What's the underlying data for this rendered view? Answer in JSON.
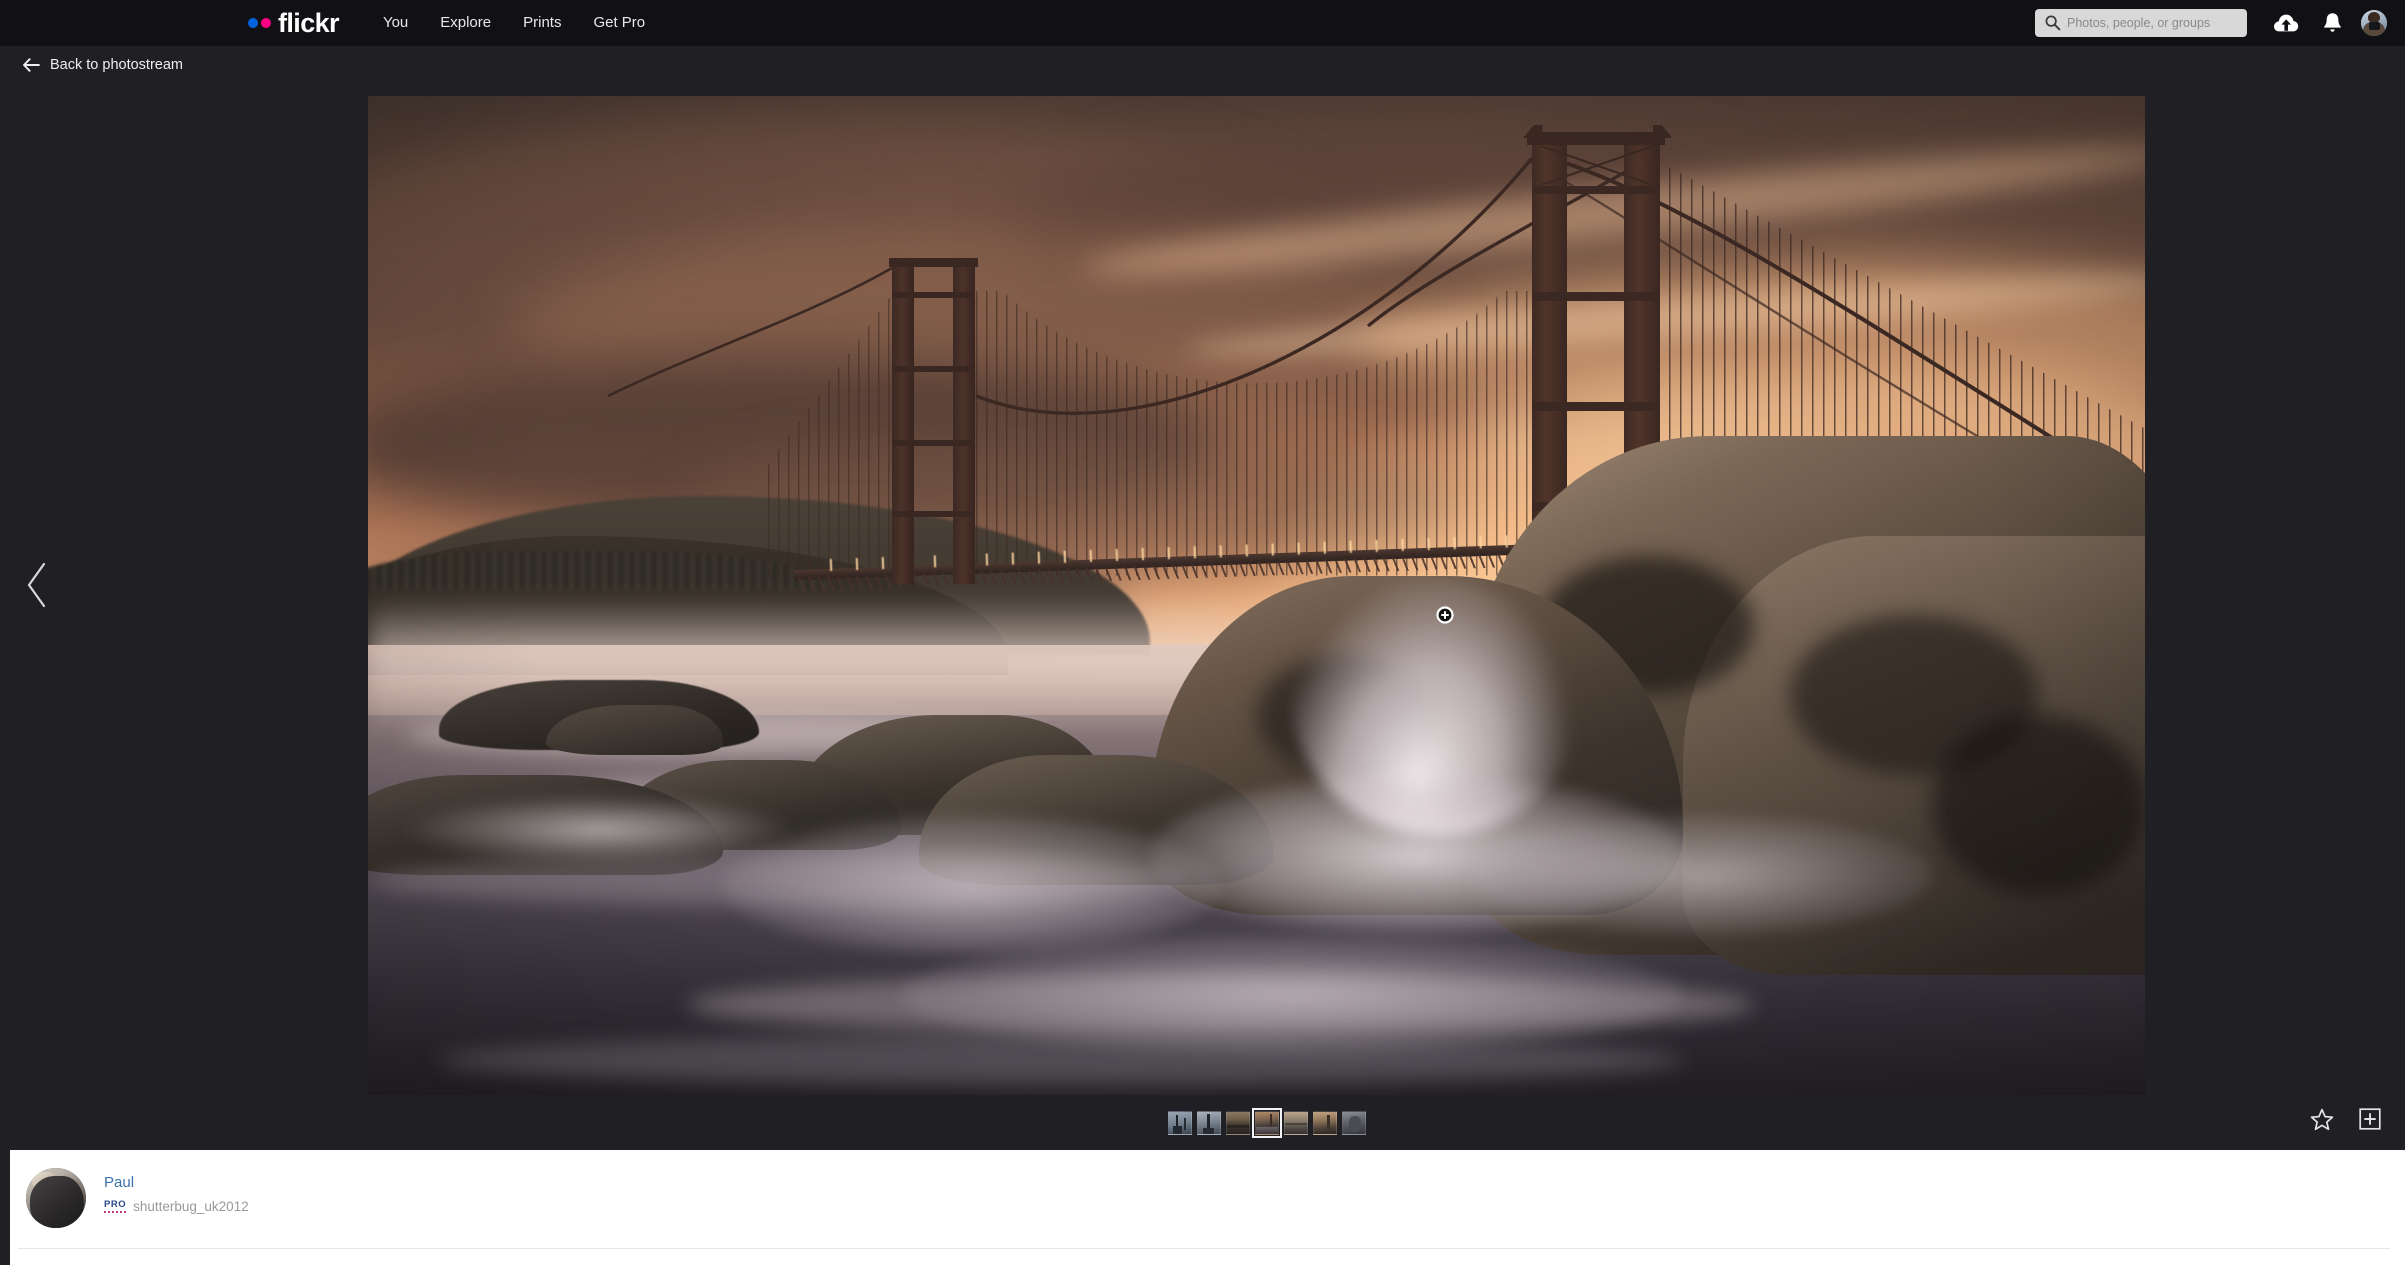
{
  "header": {
    "logo_text": "flickr",
    "logo_dot_blue": "#0063dc",
    "logo_dot_pink": "#ff0084",
    "nav": [
      {
        "label": "You",
        "name": "nav-you"
      },
      {
        "label": "Explore",
        "name": "nav-explore"
      },
      {
        "label": "Prints",
        "name": "nav-prints"
      },
      {
        "label": "Get Pro",
        "name": "nav-get-pro"
      }
    ],
    "search": {
      "placeholder": "Photos, people, or groups",
      "value": "",
      "icon": "search-icon"
    },
    "upload_icon": "cloud-upload-icon",
    "notifications_icon": "bell-icon",
    "avatar_icon": "user-avatar"
  },
  "back": {
    "label": "Back to photostream",
    "icon": "arrow-left-icon"
  },
  "photo": {
    "alt": "Golden Gate Bridge at sunset with waves crashing over rocks",
    "cursor": "zoom-in-cursor"
  },
  "prev_icon": "chevron-left-icon",
  "thumbnails": [
    {
      "name": "thumbnail-1",
      "active": false
    },
    {
      "name": "thumbnail-2",
      "active": false
    },
    {
      "name": "thumbnail-3",
      "active": false
    },
    {
      "name": "thumbnail-4",
      "active": true
    },
    {
      "name": "thumbnail-5",
      "active": false
    },
    {
      "name": "thumbnail-6",
      "active": false
    },
    {
      "name": "thumbnail-7",
      "active": false
    }
  ],
  "actions": {
    "favorite_icon": "star-icon",
    "add_to_album_icon": "add-to-album-icon"
  },
  "owner": {
    "display_name": "Paul",
    "pro_badge": "PRO",
    "username": "shutterbug_uk2012",
    "name_color": "#3a72a8"
  }
}
